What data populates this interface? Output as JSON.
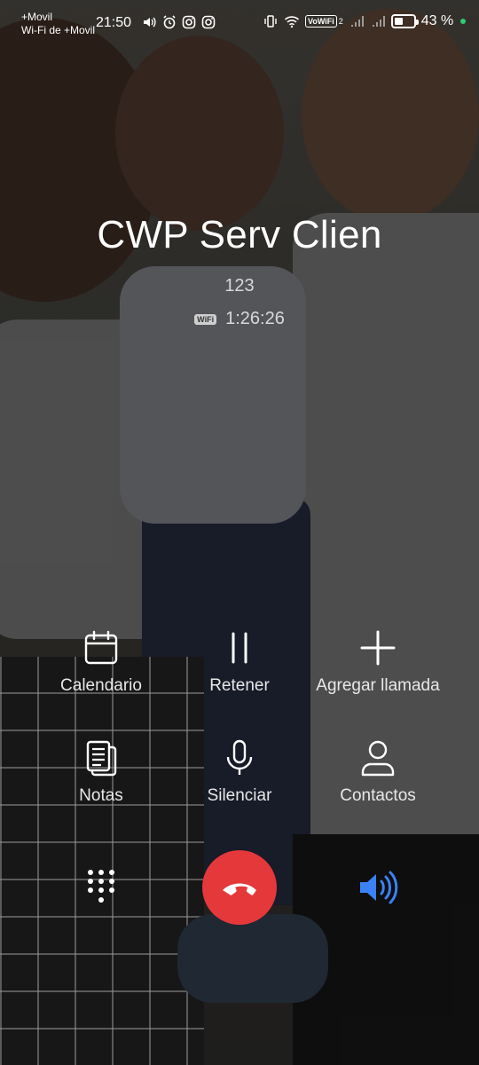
{
  "status_bar": {
    "carrier_line1": "+Movil",
    "carrier_line2": "Wi-Fi de +Movil",
    "time": "21:50",
    "vowifi": "VoWiFi",
    "vowifi_sub": "2",
    "battery_percent": "43 %",
    "battery_level": 0.43
  },
  "call": {
    "name": "CWP Serv Clien",
    "number": "123",
    "network_badge": "WiFi",
    "duration": "1:26:26"
  },
  "controls": {
    "calendar": "Calendario",
    "hold": "Retener",
    "add_call": "Agregar llamada",
    "notes": "Notas",
    "mute": "Silenciar",
    "contacts": "Contactos"
  },
  "colors": {
    "end_call": "#e5383b",
    "speaker_active": "#3b82f6"
  }
}
